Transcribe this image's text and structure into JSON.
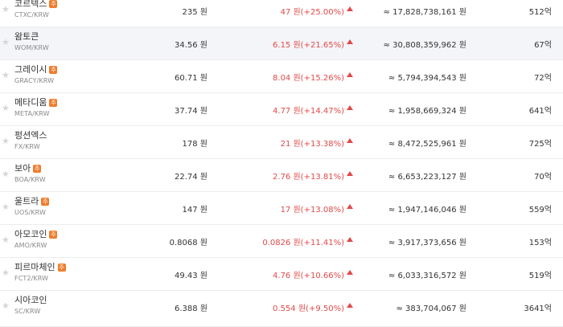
{
  "colors": {
    "up": "#e04a4a",
    "badge": "#f07c2b",
    "row_alt_bg": "#f4f5f8"
  },
  "icons": {
    "favorite": "star-icon",
    "badge": "caution-badge-icon",
    "trend": "up-triangle-icon"
  },
  "rows": [
    {
      "name": "코르텍스",
      "ticker": "CTXC/KRW",
      "badge": "주",
      "price": "235 원",
      "change": "47 원(+25.00%)",
      "volume": "≈ 17,828,738,161 원",
      "cap": "512억"
    },
    {
      "name": "왐토큰",
      "ticker": "WOM/KRW",
      "badge": "",
      "price": "34.56 원",
      "change": "6.15 원(+21.65%)",
      "volume": "≈ 30,808,359,962 원",
      "cap": "67억"
    },
    {
      "name": "그레이시",
      "ticker": "GRACY/KRW",
      "badge": "주",
      "price": "60.71 원",
      "change": "8.04 원(+15.26%)",
      "volume": "≈ 5,794,394,543 원",
      "cap": "72억"
    },
    {
      "name": "메타디움",
      "ticker": "META/KRW",
      "badge": "주",
      "price": "37.74 원",
      "change": "4.77 원(+14.47%)",
      "volume": "≈ 1,958,669,324 원",
      "cap": "641억"
    },
    {
      "name": "펑션엑스",
      "ticker": "FX/KRW",
      "badge": "",
      "price": "178 원",
      "change": "21 원(+13.38%)",
      "volume": "≈ 8,472,525,961 원",
      "cap": "725억"
    },
    {
      "name": "보아",
      "ticker": "BOA/KRW",
      "badge": "주",
      "price": "22.74 원",
      "change": "2.76 원(+13.81%)",
      "volume": "≈ 6,653,223,127 원",
      "cap": "70억"
    },
    {
      "name": "울트라",
      "ticker": "UOS/KRW",
      "badge": "주",
      "price": "147 원",
      "change": "17 원(+13.08%)",
      "volume": "≈ 1,947,146,046 원",
      "cap": "559억"
    },
    {
      "name": "아모코인",
      "ticker": "AMO/KRW",
      "badge": "주",
      "price": "0.8068 원",
      "change": "0.0826 원(+11.41%)",
      "volume": "≈ 3,917,373,656 원",
      "cap": "153억"
    },
    {
      "name": "피르마체인",
      "ticker": "FCT2/KRW",
      "badge": "주",
      "price": "49.43 원",
      "change": "4.76 원(+10.66%)",
      "volume": "≈ 6,033,316,572 원",
      "cap": "519억"
    },
    {
      "name": "시아코인",
      "ticker": "SC/KRW",
      "badge": "",
      "price": "6.388 원",
      "change": "0.554 원(+9.50%)",
      "volume": "≈ 383,704,067 원",
      "cap": "3641억"
    }
  ]
}
